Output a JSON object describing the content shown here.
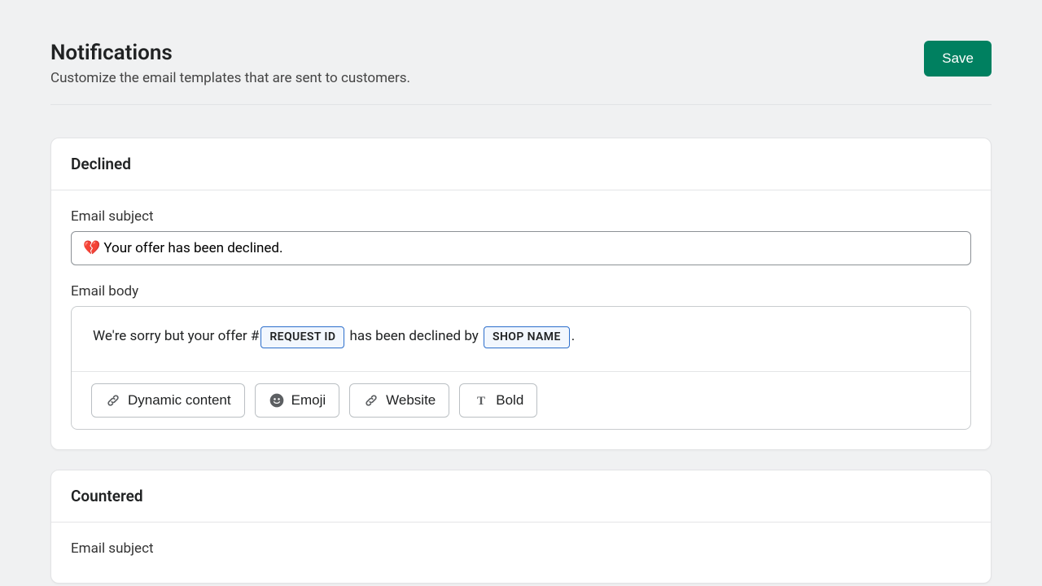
{
  "header": {
    "title": "Notifications",
    "subtitle": "Customize the email templates that are sent to customers.",
    "save_label": "Save"
  },
  "declined": {
    "title": "Declined",
    "subject_label": "Email subject",
    "subject_value": "💔 Your offer has been declined.",
    "body_label": "Email body",
    "body_text_1": "We're sorry but your offer #",
    "chip_1": "REQUEST ID",
    "body_text_2": " has been declined by ",
    "chip_2": "SHOP NAME",
    "body_text_3": ".",
    "tools": {
      "dynamic": "Dynamic content",
      "emoji": "Emoji",
      "website": "Website",
      "bold": "Bold"
    }
  },
  "countered": {
    "title": "Countered",
    "subject_label": "Email subject"
  }
}
